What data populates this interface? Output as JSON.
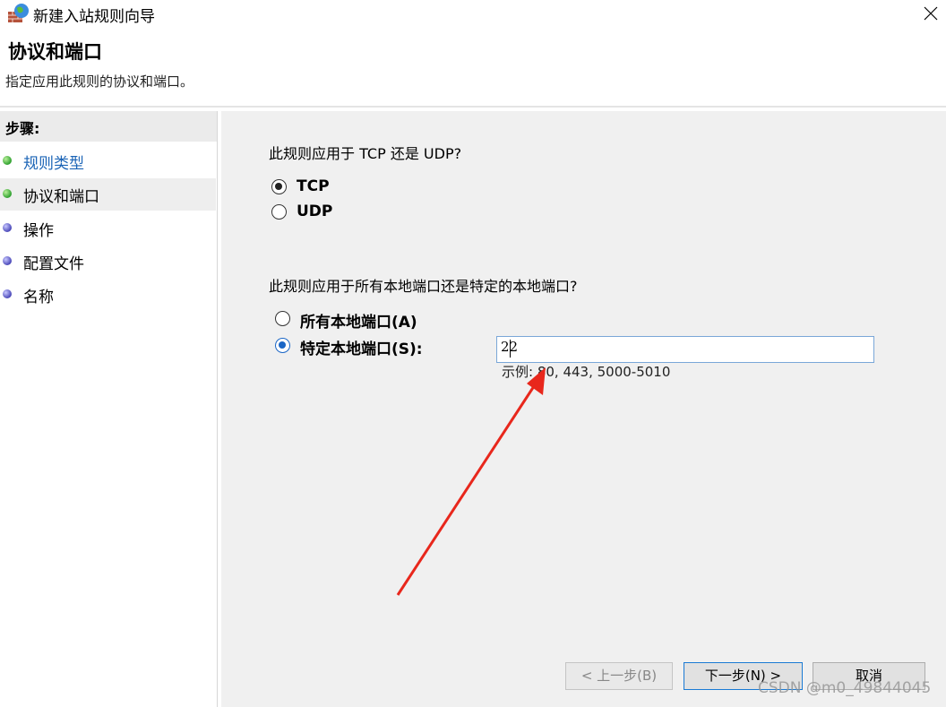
{
  "window": {
    "title": "新建入站规则向导",
    "app_icon": "firewall-globe-icon",
    "close_icon": "close-icon"
  },
  "header": {
    "title": "协议和端口",
    "subtitle": "指定应用此规则的协议和端口。"
  },
  "sidebar": {
    "steps_header": "步骤:",
    "items": [
      {
        "label": "规则类型",
        "status": "done",
        "link": true
      },
      {
        "label": "协议和端口",
        "status": "done",
        "active": true
      },
      {
        "label": "操作",
        "status": "todo"
      },
      {
        "label": "配置文件",
        "status": "todo"
      },
      {
        "label": "名称",
        "status": "todo"
      }
    ]
  },
  "main": {
    "protocol_question": "此规则应用于 TCP 还是 UDP?",
    "protocol_options": [
      {
        "label": "TCP",
        "selected": true
      },
      {
        "label": "UDP",
        "selected": false
      }
    ],
    "port_question": "此规则应用于所有本地端口还是特定的本地端口?",
    "port_options": [
      {
        "label": "所有本地端口(A)",
        "selected": false
      },
      {
        "label": "特定本地端口(S):",
        "selected": true
      }
    ],
    "port_input_value": "22",
    "port_hint": "示例: 80, 443, 5000-5010"
  },
  "buttons": {
    "back": "< 上一步(B)",
    "next": "下一步(N) >",
    "cancel": "取消"
  },
  "annotation": {
    "color": "#e8271c"
  },
  "watermark": "CSDN @m0_49844045"
}
